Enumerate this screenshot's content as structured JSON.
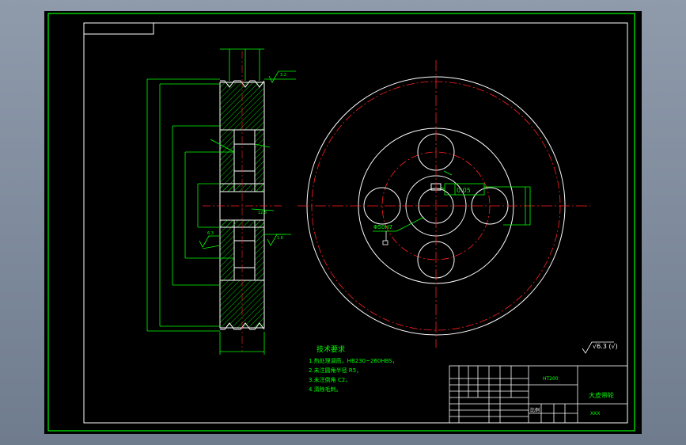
{
  "colors": {
    "background": "#000000",
    "frame": "#00ff00",
    "outline": "#ffffff",
    "centerline": "#ff2020",
    "dimension": "#00ff00",
    "hatch": "#00ff00",
    "viewport_bg": "#7f8a9c"
  },
  "tech_requirements": {
    "title": "技术要求",
    "items": [
      "1.热处理调质，HB230~260HBS，",
      "2.未注圆角半径 R5，",
      "3.未注倒角 C2，",
      "4.清除毛刺。"
    ]
  },
  "roughness_note": "√6.3 (√)",
  "title_block": {
    "drawing_no": "HT200",
    "part_name": "大皮带轮",
    "small_text": "比例",
    "school": "XXX"
  },
  "dimensions": {
    "tolerance_frame": "0.05",
    "hole_callout": "Φ50H7",
    "roughness_values": [
      "3.2",
      "1.6",
      "6.3",
      "12.5"
    ]
  }
}
